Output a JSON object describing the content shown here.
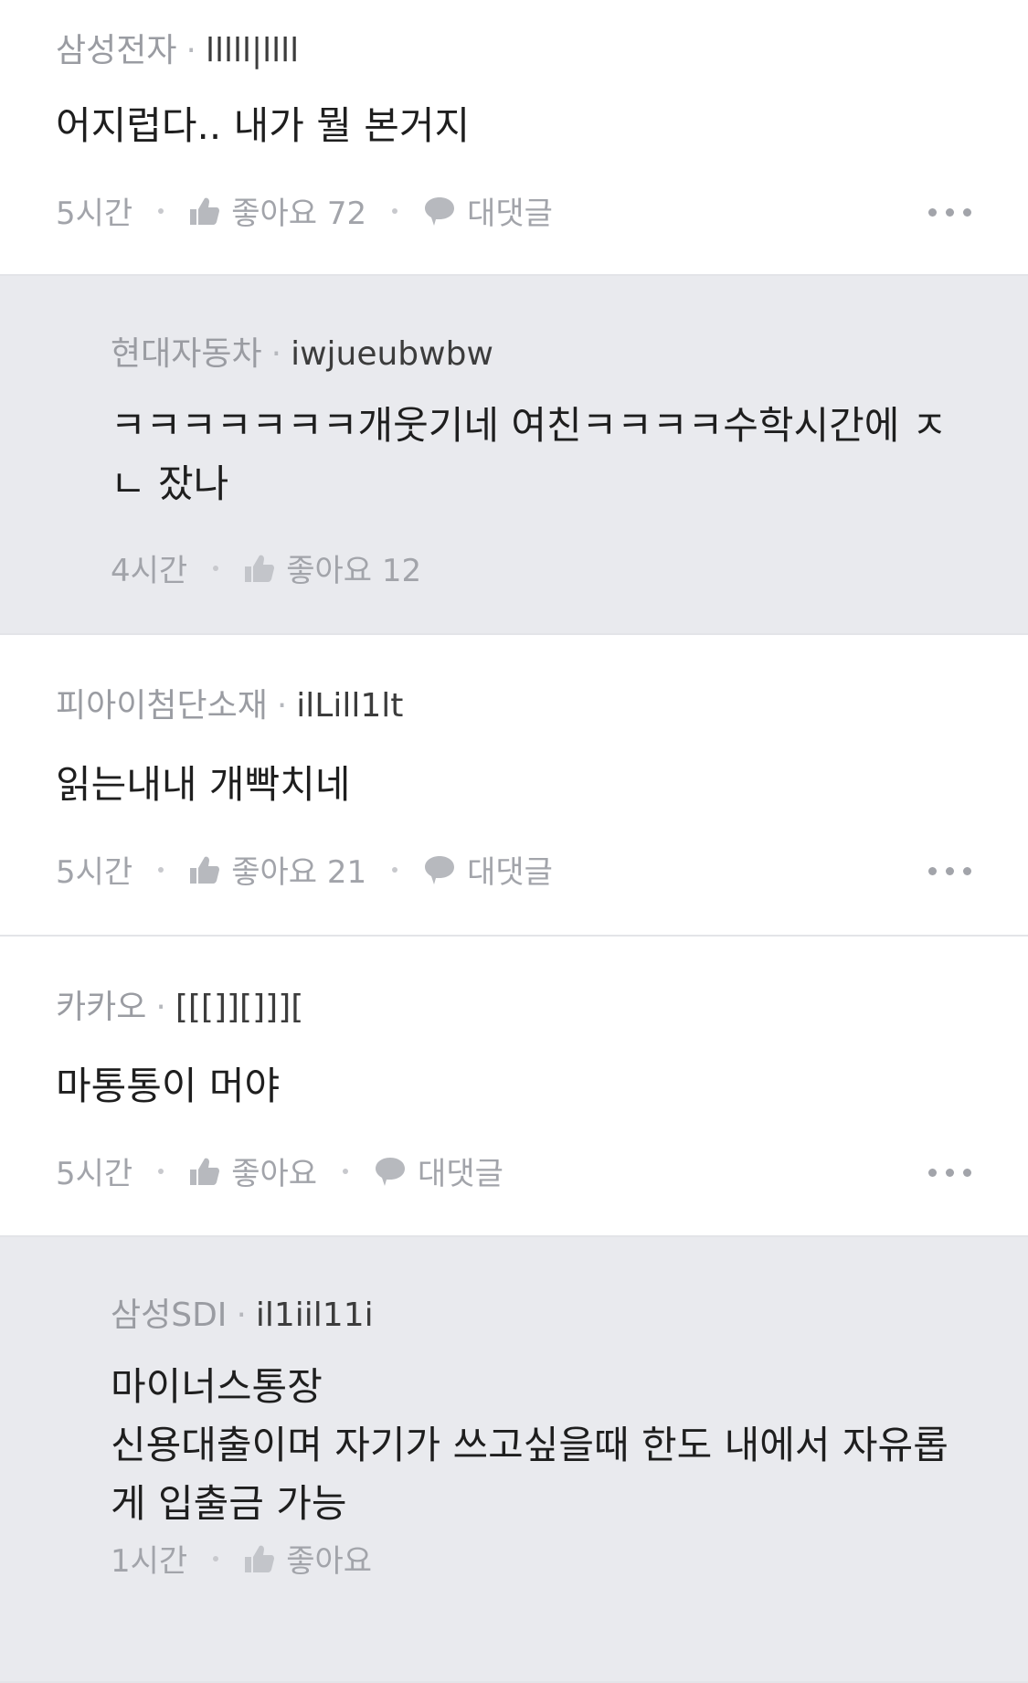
{
  "comments": [
    {
      "company": "삼성전자",
      "separator": "·",
      "user": "lllll|llll",
      "text": "어지럽다.. 내가 뭘 본거지",
      "time": "5시간",
      "like_label": "좋아요 72",
      "reply_label": "대댓글"
    },
    {
      "company": "현대자동차",
      "separator": "·",
      "user": "iwjueubwbw",
      "text": "ㅋㅋㅋㅋㅋㅋㅋ개웃기네 여친ㅋㅋㅋㅋ수학시간에 ㅈㄴ 잤나",
      "time": "4시간",
      "like_label": "좋아요 12"
    },
    {
      "company": "피아이첨단소재",
      "separator": "·",
      "user": "ilLill1lt",
      "text": "읽는내내 개빡치네",
      "time": "5시간",
      "like_label": "좋아요 21",
      "reply_label": "대댓글"
    },
    {
      "company": "카카오",
      "separator": "·",
      "user": "[[[]][]]][",
      "text": "마통통이 머야",
      "time": "5시간",
      "like_label": "좋아요",
      "reply_label": "대댓글"
    },
    {
      "company": "삼성SDI",
      "separator": "·",
      "user": "il1iil11i",
      "text": "마이너스통장\n신용대출이며 자기가 쓰고싶을때 한도 내에서 자유롭게 입출금 가능",
      "time": "1시간",
      "like_label": "좋아요"
    }
  ],
  "colors": {
    "reply_background": "#e9eaee",
    "muted_text": "#a2a4aa",
    "divider": "#e3e4e8"
  },
  "icons": {
    "like": "thumbs-up-icon",
    "reply": "speech-bubble-icon",
    "more": "ellipsis-icon"
  }
}
